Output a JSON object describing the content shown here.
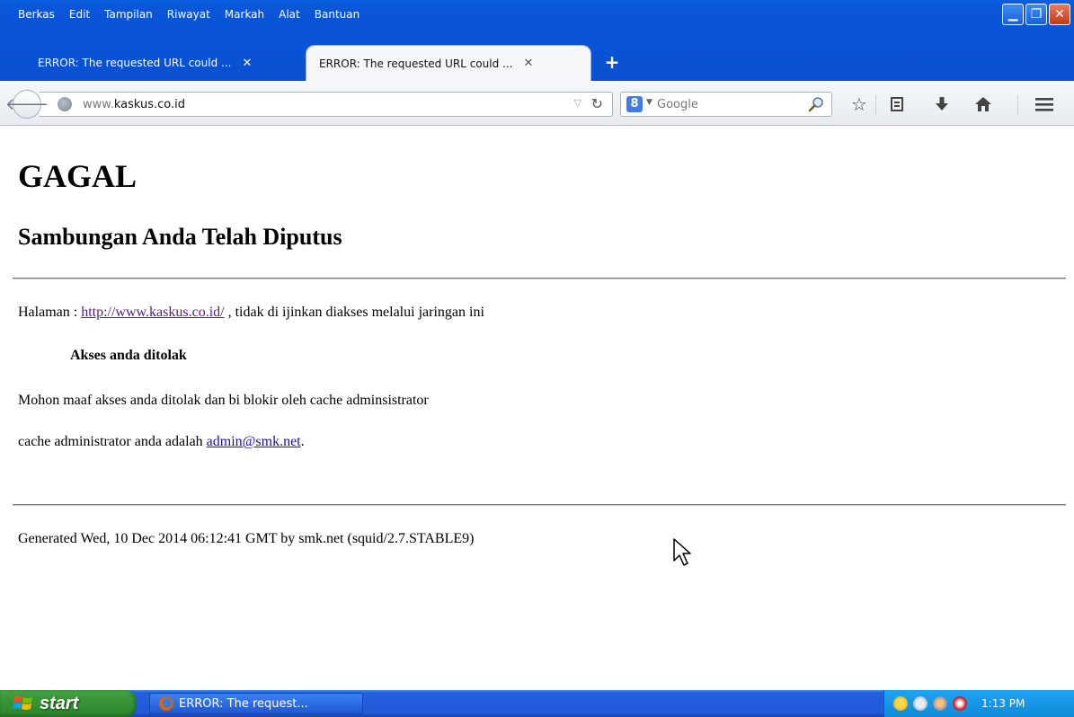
{
  "menubar": {
    "items": [
      {
        "label": "Berkas"
      },
      {
        "label": "Edit"
      },
      {
        "label": "Tampilan"
      },
      {
        "label": "Riwayat"
      },
      {
        "label": "Markah"
      },
      {
        "label": "Alat"
      },
      {
        "label": "Bantuan"
      }
    ]
  },
  "tabs": [
    {
      "title": "ERROR: The requested URL could ...",
      "close": "✕",
      "active": false
    },
    {
      "title": "ERROR: The requested URL could ...",
      "close": "✕",
      "active": true
    }
  ],
  "new_tab": "+",
  "navbar": {
    "url_prefix": "www.",
    "url_domain": "kaskus.co.id",
    "search_engine_letter": "8",
    "search_placeholder": "Google"
  },
  "page": {
    "heading": "GAGAL",
    "subheading": "Sambungan Anda Telah Diputus",
    "halaman_prefix": "Halaman : ",
    "halaman_link": "http://www.kaskus.co.id/",
    "halaman_suffix": " , tidak di ijinkan diakses melalui jaringan ini",
    "access_denied": "Akses anda ditolak",
    "mohon": "Mohon maaf akses anda ditolak dan bi blokir oleh cache adminsistrator",
    "admin_prefix": "cache administrator anda adalah ",
    "admin_email": "admin@smk.net",
    "admin_suffix": ".",
    "generated": "Generated Wed, 10 Dec 2014 06:12:41 GMT by smk.net (squid/2.7.STABLE9)"
  },
  "taskbar": {
    "start_label": "start",
    "task_label": "ERROR: The request...",
    "clock": "1:13 PM"
  },
  "colors": {
    "xp_blue": "#0a55d8",
    "start_green": "#3c9a3c",
    "visited_link": "#551a8b",
    "link": "#1a0dab"
  }
}
